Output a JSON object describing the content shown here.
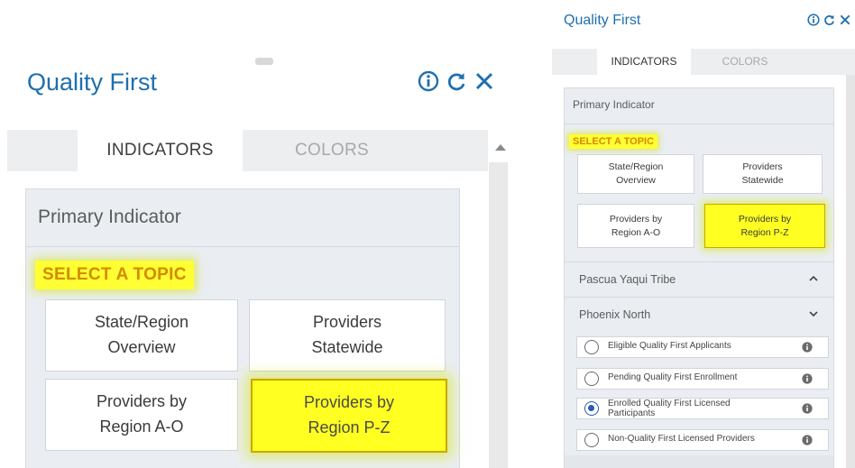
{
  "app": {
    "title": "Quality First",
    "tabs": [
      "INDICATORS",
      "COLORS"
    ],
    "primary_indicator_label": "Primary Indicator",
    "select_topic_label": "SELECT A TOPIC",
    "topics": [
      {
        "label_line1": "State/Region",
        "label_line2": "Overview",
        "selected": false
      },
      {
        "label_line1": "Providers",
        "label_line2": "Statewide",
        "selected": false
      },
      {
        "label_line1": "Providers by",
        "label_line2": "Region A-O",
        "selected": false
      },
      {
        "label_line1": "Providers by",
        "label_line2": "Region P-Z",
        "selected": true
      }
    ],
    "regions": [
      {
        "label": "Pascua Yaqui Tribe",
        "expanded": true
      },
      {
        "label": "Phoenix North",
        "expanded": false
      }
    ],
    "indicators": [
      {
        "label": "Eligible Quality First Applicants",
        "checked": false
      },
      {
        "label": "Pending Quality First Enrollment",
        "checked": false
      },
      {
        "label_line1": "Enrolled Quality First Licensed",
        "label_line2": "Participants",
        "checked": true
      },
      {
        "label": "Non-Quality First Licensed Providers",
        "checked": false
      }
    ]
  },
  "icons": {
    "info": "info-circle-icon",
    "refresh": "refresh-icon",
    "close": "close-icon",
    "collapse": "chevron-up-icon",
    "expand": "chevron-down-icon",
    "indicator_info": "info-filled-icon"
  },
  "colors": {
    "brand_blue": "#1f6fae",
    "highlight_yellow": "#ffff33",
    "topic_text_orange": "#d58a00",
    "radio_selected": "#2a58b8"
  }
}
